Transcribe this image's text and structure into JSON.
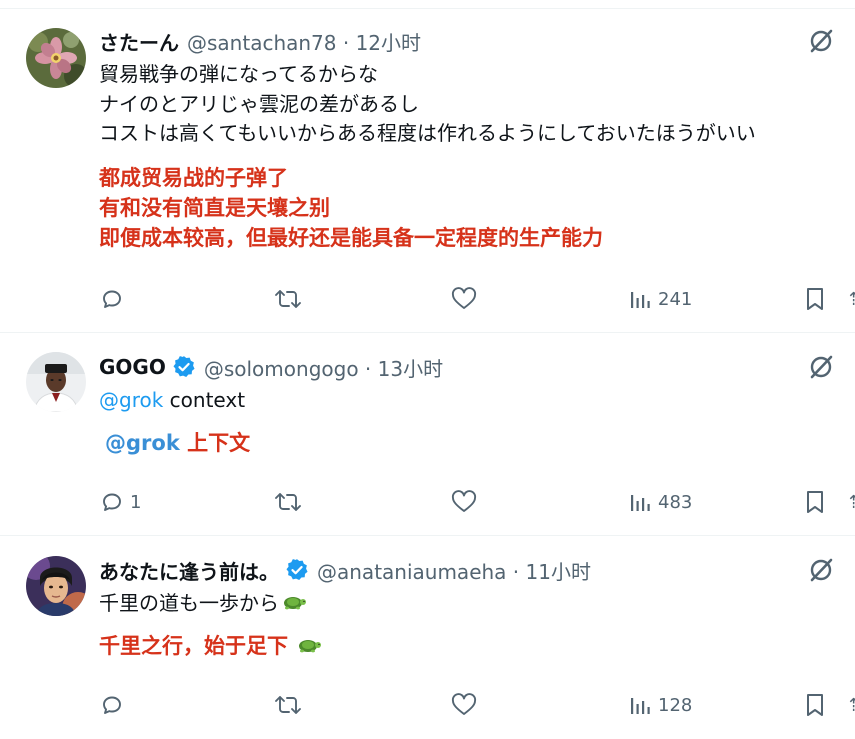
{
  "tweets": [
    {
      "display_name": "さたーん",
      "handle_meta": "@santachan78 · 12小时",
      "verified": false,
      "body_lines": [
        "貿易戦争の弾になってるからな",
        "ナイのとアリじゃ雲泥の差があるし",
        "コストは高くてもいいからある程度は作れるようにしておいたほうがいい"
      ],
      "translation_lines": [
        "都成贸易战的子弹了",
        "有和没有简直是天壤之别",
        "即便成本较高，但最好还是能具备一定程度的生产能力"
      ],
      "actions": {
        "reply": "",
        "retweet": "",
        "like": "",
        "views": "241"
      }
    },
    {
      "display_name": "GOGO",
      "handle_meta": "@solomongogo · 13小时",
      "verified": true,
      "body": {
        "mention": "@grok",
        "text": " context"
      },
      "translation": {
        "mention": "@grok",
        "text": " 上下文"
      },
      "actions": {
        "reply": "1",
        "retweet": "",
        "like": "",
        "views": "483"
      }
    },
    {
      "display_name": "あなたに逢う前は。",
      "handle_meta": "@anataniaumaeha · 11小时",
      "verified": true,
      "body_text": "千里の道も一歩から",
      "translation_text": "千里之行，始于足下",
      "actions": {
        "reply": "",
        "retweet": "",
        "like": "",
        "views": "128"
      }
    }
  ],
  "icons": {
    "reply": "reply-icon",
    "retweet": "retweet-icon",
    "like": "like-icon",
    "views": "views-icon",
    "bookmark": "bookmark-icon",
    "grok": "grok-icon",
    "verified": "verified-badge-icon",
    "turtle": "turtle-emoji"
  },
  "colors": {
    "text": "#0f1419",
    "muted": "#536471",
    "mention": "#1d9bf0",
    "translation": "#d6321a",
    "verified": "#1d9bf0",
    "divider": "#eff3f4"
  }
}
